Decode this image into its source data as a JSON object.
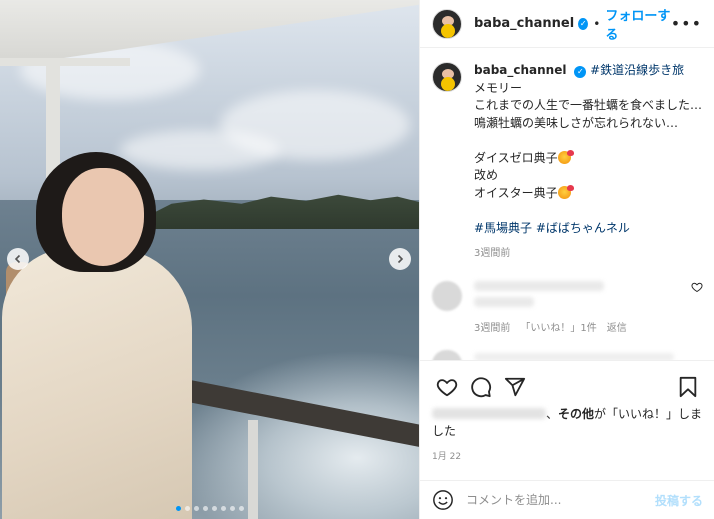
{
  "post": {
    "username": "baba_channel",
    "verified_mark": "✓",
    "dot": "•",
    "follow_label": "フォローする",
    "more_label": "•••",
    "image_alt_icons": [
      "chevron-left-icon",
      "chevron-right-icon"
    ],
    "carousel": {
      "count": 8,
      "active_index": 0
    }
  },
  "caption": {
    "username": "baba_channel",
    "first_hashtag": "#鉄道沿線歩き旅",
    "lines": [
      "メモリー",
      "これまでの人生で一番牡蠣を食べました…",
      "鳴瀬牡蠣の美味しさが忘れられない…",
      "",
      "ダイスゼロ典子",
      "改め",
      "オイスター典子"
    ],
    "hashtags": "#馬場典子 #ばばちゃんネル",
    "time": "3週間前"
  },
  "comment": {
    "time": "3週間前",
    "likes": "「いいね！」1件",
    "reply": "返信"
  },
  "actions": {
    "icons": [
      "heart-icon",
      "comment-icon",
      "share-icon",
      "bookmark-icon"
    ]
  },
  "likes_line": {
    "separator": "、",
    "others": "その他",
    "suffix": "が「いいね！」しました"
  },
  "date": "1月 22",
  "add_comment": {
    "placeholder": "コメントを追加...",
    "post_label": "投稿する"
  },
  "colors": {
    "accent": "#0095f6",
    "link": "#00376b",
    "muted": "#8e8e8e",
    "post_disabled": "#b2dffc"
  }
}
